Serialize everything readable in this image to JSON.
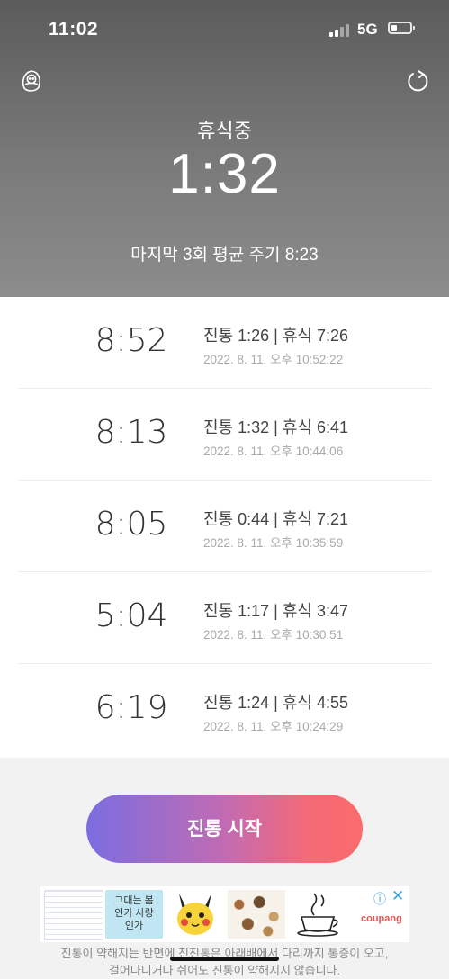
{
  "status_bar": {
    "time": "11:02",
    "network": "5G"
  },
  "header": {
    "status_label": "휴식중",
    "timer": "1:32",
    "average": "마지막 3회 평균 주기 8:23"
  },
  "records": [
    {
      "cycle": "8:52",
      "detail": "진통 1:26 | 휴식 7:26",
      "timestamp": "2022. 8. 11. 오후 10:52:22"
    },
    {
      "cycle": "8:13",
      "detail": "진통 1:32 | 휴식 6:41",
      "timestamp": "2022. 8. 11. 오후 10:44:06"
    },
    {
      "cycle": "8:05",
      "detail": "진통 0:44 | 휴식 7:21",
      "timestamp": "2022. 8. 11. 오후 10:35:59"
    },
    {
      "cycle": "5:04",
      "detail": "진통 1:17 | 휴식 3:47",
      "timestamp": "2022. 8. 11. 오후 10:30:51"
    },
    {
      "cycle": "6:19",
      "detail": "진통 1:24 | 휴식 4:55",
      "timestamp": "2022. 8. 11. 오후 10:24:29"
    }
  ],
  "start_button": {
    "label": "진통 시작"
  },
  "ad": {
    "close": "✕",
    "info": "ⓘ",
    "brand": "coupang",
    "thumb2_text": "그대는 봄인가 사랑인가"
  },
  "notice": {
    "line1": "진통이 약해지는 반면에 진진통은 아래배에서 다리까지 통증이 오고,",
    "line2": "걸어다니거나 쉬어도 진통이 약해지지 않습니다."
  },
  "colors": {
    "header_bg": "#7a7a7a",
    "button_start": "#7b6de0",
    "button_end": "#fb6b6b",
    "ad_accent": "#3aa3e6"
  },
  "icons": {
    "left": "baby-icon",
    "right": "refresh-icon"
  }
}
